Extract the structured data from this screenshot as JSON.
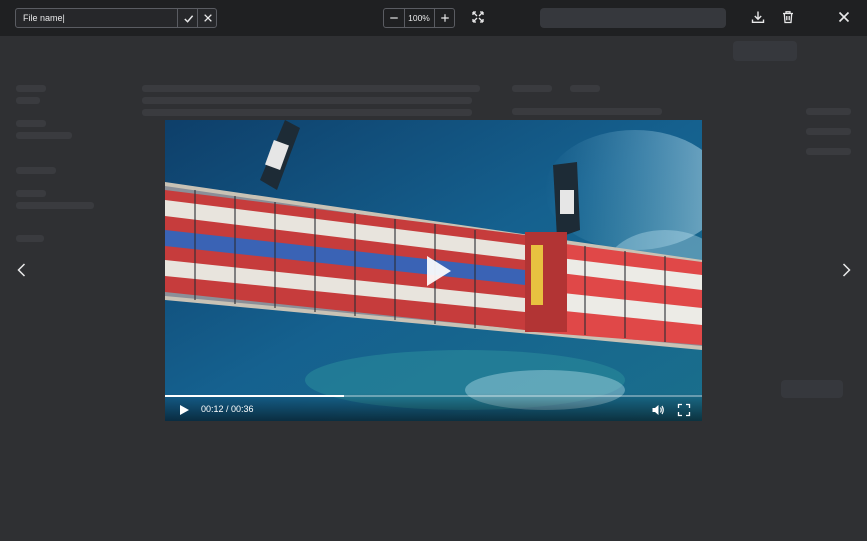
{
  "file_name_field": {
    "value": "File name|"
  },
  "zoom": {
    "value": "100%"
  },
  "player": {
    "time": "00:12 / 00:36",
    "progress_fraction": 0.3333
  },
  "icons": {
    "confirm": "check-icon",
    "cancel": "close-icon",
    "zoom_out": "minus-icon",
    "zoom_in": "plus-icon",
    "fit": "expand-icon",
    "download": "download-icon",
    "delete": "trash-icon",
    "close": "close-icon",
    "prev": "chevron-left-icon",
    "next": "chevron-right-icon",
    "play": "play-icon",
    "volume": "volume-icon",
    "fullscreen": "fullscreen-icon"
  },
  "colors": {
    "overlay": "#2c2d30",
    "toolbar": "#1f2022",
    "icon": "#e9e9ea",
    "sea": "#0f4f7f",
    "progress": "#ffffff"
  }
}
